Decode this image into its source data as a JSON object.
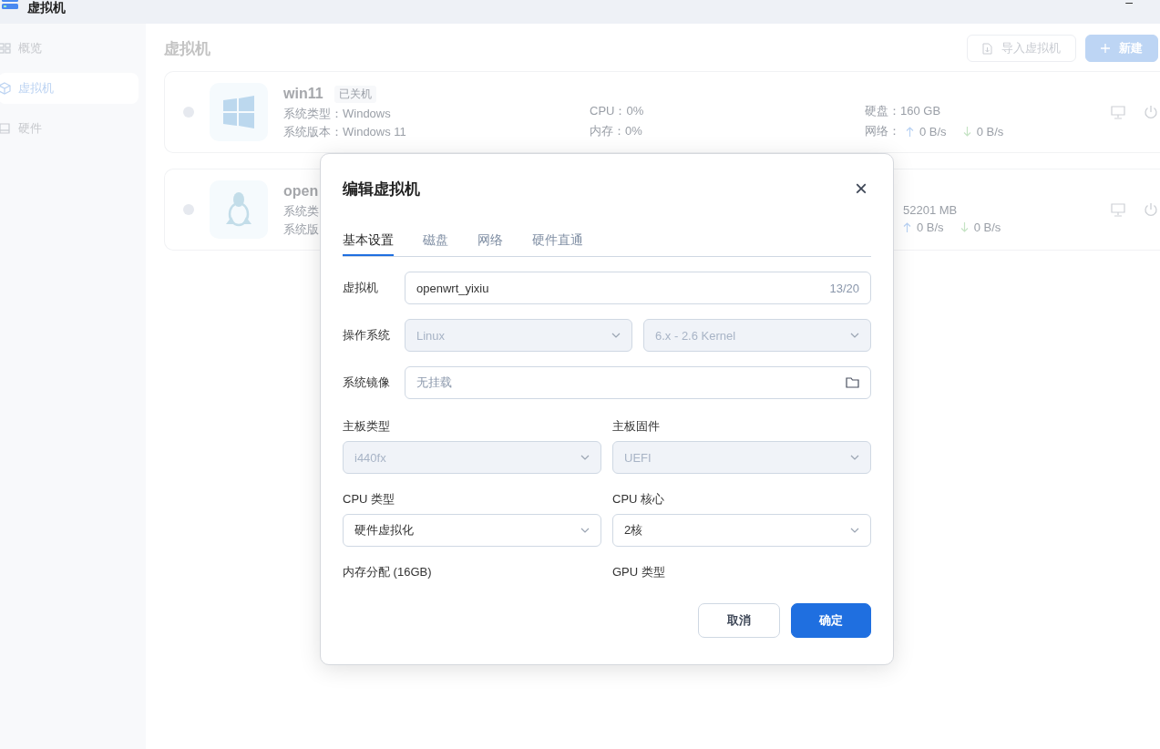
{
  "window": {
    "title": "虚拟机",
    "minimize": "–"
  },
  "sidebar": {
    "items": [
      {
        "label": "概览",
        "selected": false
      },
      {
        "label": "虚拟机",
        "selected": true
      },
      {
        "label": "硬件",
        "selected": false
      }
    ]
  },
  "main": {
    "heading": "虚拟机",
    "buttons": [
      {
        "label": "导入虚拟机",
        "kind": "outline"
      },
      {
        "label": "新建",
        "kind": "primary"
      }
    ],
    "vms": [
      {
        "name": "win11",
        "state": "已关机",
        "lines": [
          "系统类型：Windows",
          "系统版本：Windows 11"
        ],
        "cpu": "CPU：0%",
        "memory": "内存：0%",
        "disk": "硬盘：160 GB",
        "net_label": "网络：",
        "up": "0 B/s",
        "down": "0 B/s"
      },
      {
        "name": "open",
        "lines": [
          "系统类",
          "系统版"
        ],
        "disk": "52201 MB",
        "up": "0 B/s",
        "down": "0 B/s"
      }
    ]
  },
  "dialog": {
    "title": "编辑虚拟机",
    "close": "×",
    "tabs": [
      {
        "label": "基本设置",
        "selected": true
      },
      {
        "label": "磁盘",
        "selected": false
      },
      {
        "label": "网络",
        "selected": false
      },
      {
        "label": "硬件直通",
        "selected": false
      }
    ],
    "rows": [
      {
        "kind": "text",
        "label": "虚拟机",
        "value": "openwrt_yixiu",
        "counter": "13/20"
      },
      {
        "kind": "selects",
        "label": "操作系统",
        "selects": [
          {
            "value": "Linux",
            "disabled": true
          },
          {
            "value": "6.x - 2.6 Kernel",
            "disabled": true
          }
        ]
      },
      {
        "kind": "file",
        "label": "系统镜像",
        "placeholder": "无挂载"
      }
    ],
    "grid": [
      {
        "label": "主板类型",
        "select": {
          "value": "i440fx",
          "disabled": true
        }
      },
      {
        "label": "主板固件",
        "select": {
          "value": "UEFI",
          "disabled": true
        }
      },
      {
        "label": "CPU 类型",
        "select": {
          "value": "硬件虚拟化",
          "disabled": false
        }
      },
      {
        "label": "CPU 核心",
        "select": {
          "value": "2核",
          "disabled": false
        }
      },
      {
        "label": "内存分配 (16GB)"
      },
      {
        "label": "GPU 类型"
      }
    ],
    "buttons": [
      {
        "label": "取消",
        "kind": "secondary"
      },
      {
        "label": "确定",
        "kind": "primary"
      }
    ]
  }
}
